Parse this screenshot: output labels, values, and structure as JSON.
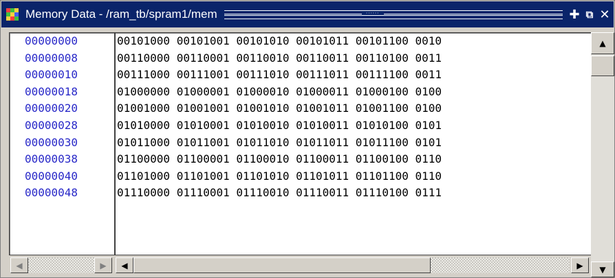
{
  "window": {
    "title": "Memory Data - /ram_tb/spram1/mem",
    "grip_dots": "::::::"
  },
  "titlebar_buttons": {
    "add_icon": "plus-icon",
    "undock_icon": "undock-icon",
    "close_icon": "close-icon"
  },
  "addresses": [
    "00000000",
    "00000008",
    "00000010",
    "00000018",
    "00000020",
    "00000028",
    "00000030",
    "00000038",
    "00000040",
    "00000048"
  ],
  "rows": [
    "00101000 00101001 00101010 00101011 00101100 0010",
    "00110000 00110001 00110010 00110011 00110100 0011",
    "00111000 00111001 00111010 00111011 00111100 0011",
    "01000000 01000001 01000010 01000011 01000100 0100",
    "01001000 01001001 01001010 01001011 01001100 0100",
    "01010000 01010001 01010010 01010011 01010100 0101",
    "01011000 01011001 01011010 01011011 01011100 0101",
    "01100000 01100001 01100010 01100011 01100100 0110",
    "01101000 01101001 01101010 01101011 01101100 0110",
    "01110000 01110001 01110010 01110011 01110100 0111"
  ],
  "colors": {
    "titlebar": "#0a246a",
    "address_text": "#2828c8",
    "data_text": "#000000",
    "window_bg": "#d4d0c8"
  }
}
